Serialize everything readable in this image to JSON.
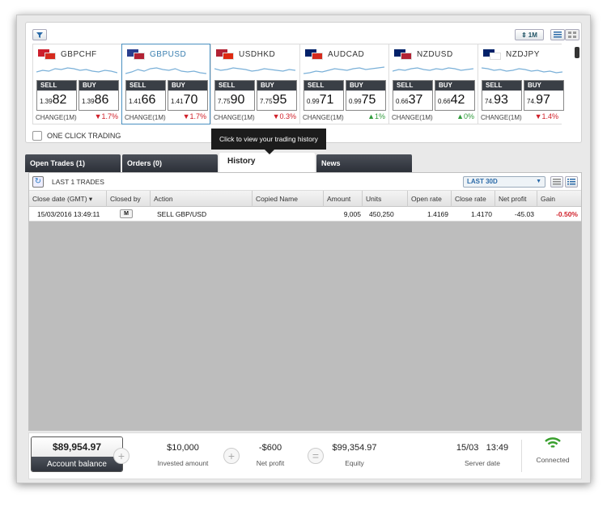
{
  "header": {
    "filter_icon": "filter-icon",
    "period_label": "1M",
    "period_icon": "updown-arrows-icon"
  },
  "tickers": [
    {
      "pair": "GBPCHF",
      "flags": [
        "#cc1f2d",
        "#d52b1e"
      ],
      "sell_small": "1.39",
      "sell_big": "82",
      "buy_small": "1.39",
      "buy_big": "86",
      "change_label": "CHANGE(1M)",
      "change": "1.7%",
      "dir": "down",
      "spark": [
        8,
        10,
        9,
        12,
        11,
        13,
        12,
        10,
        11,
        9,
        8,
        10,
        9,
        7
      ]
    },
    {
      "pair": "GBPUSD",
      "flags": [
        "#2a3f8f",
        "#b22234"
      ],
      "sell_small": "1.41",
      "sell_big": "66",
      "buy_small": "1.41",
      "buy_big": "70",
      "change_label": "CHANGE(1M)",
      "change": "1.7%",
      "dir": "down",
      "spark": [
        6,
        8,
        11,
        9,
        12,
        13,
        11,
        10,
        12,
        9,
        8,
        9,
        7,
        6
      ]
    },
    {
      "pair": "USDHKD",
      "flags": [
        "#b22234",
        "#de2910"
      ],
      "sell_small": "7.75",
      "sell_big": "90",
      "buy_small": "7.75",
      "buy_big": "95",
      "change_label": "CHANGE(1M)",
      "change": "0.3%",
      "dir": "down",
      "spark": [
        12,
        10,
        11,
        13,
        12,
        11,
        9,
        10,
        12,
        11,
        10,
        9,
        11,
        10
      ]
    },
    {
      "pair": "AUDCAD",
      "flags": [
        "#012169",
        "#d52b1e"
      ],
      "sell_small": "0.99",
      "sell_big": "71",
      "buy_small": "0.99",
      "buy_big": "75",
      "change_label": "CHANGE(1M)",
      "change": "1%",
      "dir": "up",
      "spark": [
        6,
        7,
        9,
        8,
        10,
        12,
        11,
        10,
        12,
        13,
        11,
        12,
        13,
        14
      ]
    },
    {
      "pair": "NZDUSD",
      "flags": [
        "#012169",
        "#b22234"
      ],
      "sell_small": "0.66",
      "sell_big": "37",
      "buy_small": "0.66",
      "buy_big": "42",
      "change_label": "CHANGE(1M)",
      "change": "0%",
      "dir": "up",
      "spark": [
        9,
        11,
        10,
        12,
        13,
        11,
        10,
        12,
        11,
        13,
        12,
        10,
        11,
        12
      ]
    },
    {
      "pair": "NZDJPY",
      "flags": [
        "#012169",
        "#ffffff"
      ],
      "sell_small": "74.",
      "sell_big": "93",
      "buy_small": "74.",
      "buy_big": "97",
      "change_label": "CHANGE(1M)",
      "change": "1.4%",
      "dir": "down",
      "spark": [
        13,
        12,
        10,
        11,
        9,
        10,
        12,
        11,
        9,
        10,
        8,
        9,
        7,
        8
      ]
    }
  ],
  "labels": {
    "sell": "SELL",
    "buy": "BUY",
    "one_click": "ONE CLICK TRADING",
    "tooltip": "Click to view your trading history"
  },
  "tabs": [
    "Open Trades (1)",
    "Orders (0)",
    "History",
    "News"
  ],
  "history": {
    "count_label": "LAST 1 TRADES",
    "range": "LAST 30D",
    "columns": [
      "Close date (GMT)",
      "Closed by",
      "Action",
      "Copied Name",
      "Amount",
      "Units",
      "Open rate",
      "Close rate",
      "Net profit",
      "Gain"
    ],
    "rows": [
      {
        "close_date": "15/03/2016 13:49:11",
        "closed_by": "M",
        "action": "SELL GBP/USD",
        "copied_name": "",
        "amount": "9,005",
        "units": "450,250",
        "open_rate": "1.4169",
        "close_rate": "1.4170",
        "net_profit": "-45.03",
        "gain": "-0.50%"
      }
    ]
  },
  "footer": {
    "account_balance_value": "$89,954.97",
    "account_balance_label": "Account balance",
    "invested_value": "$10,000",
    "invested_label": "Invested amount",
    "net_profit_value": "-$600",
    "net_profit_label": "Net profit",
    "equity_value": "$99,354.97",
    "equity_label": "Equity",
    "server_date": "15/03",
    "server_time": "13:49",
    "server_label": "Server date",
    "connection_label": "Connected",
    "plus_symbol": "+",
    "equals_symbol": "=",
    "wifi_color": "#3aa02e"
  }
}
